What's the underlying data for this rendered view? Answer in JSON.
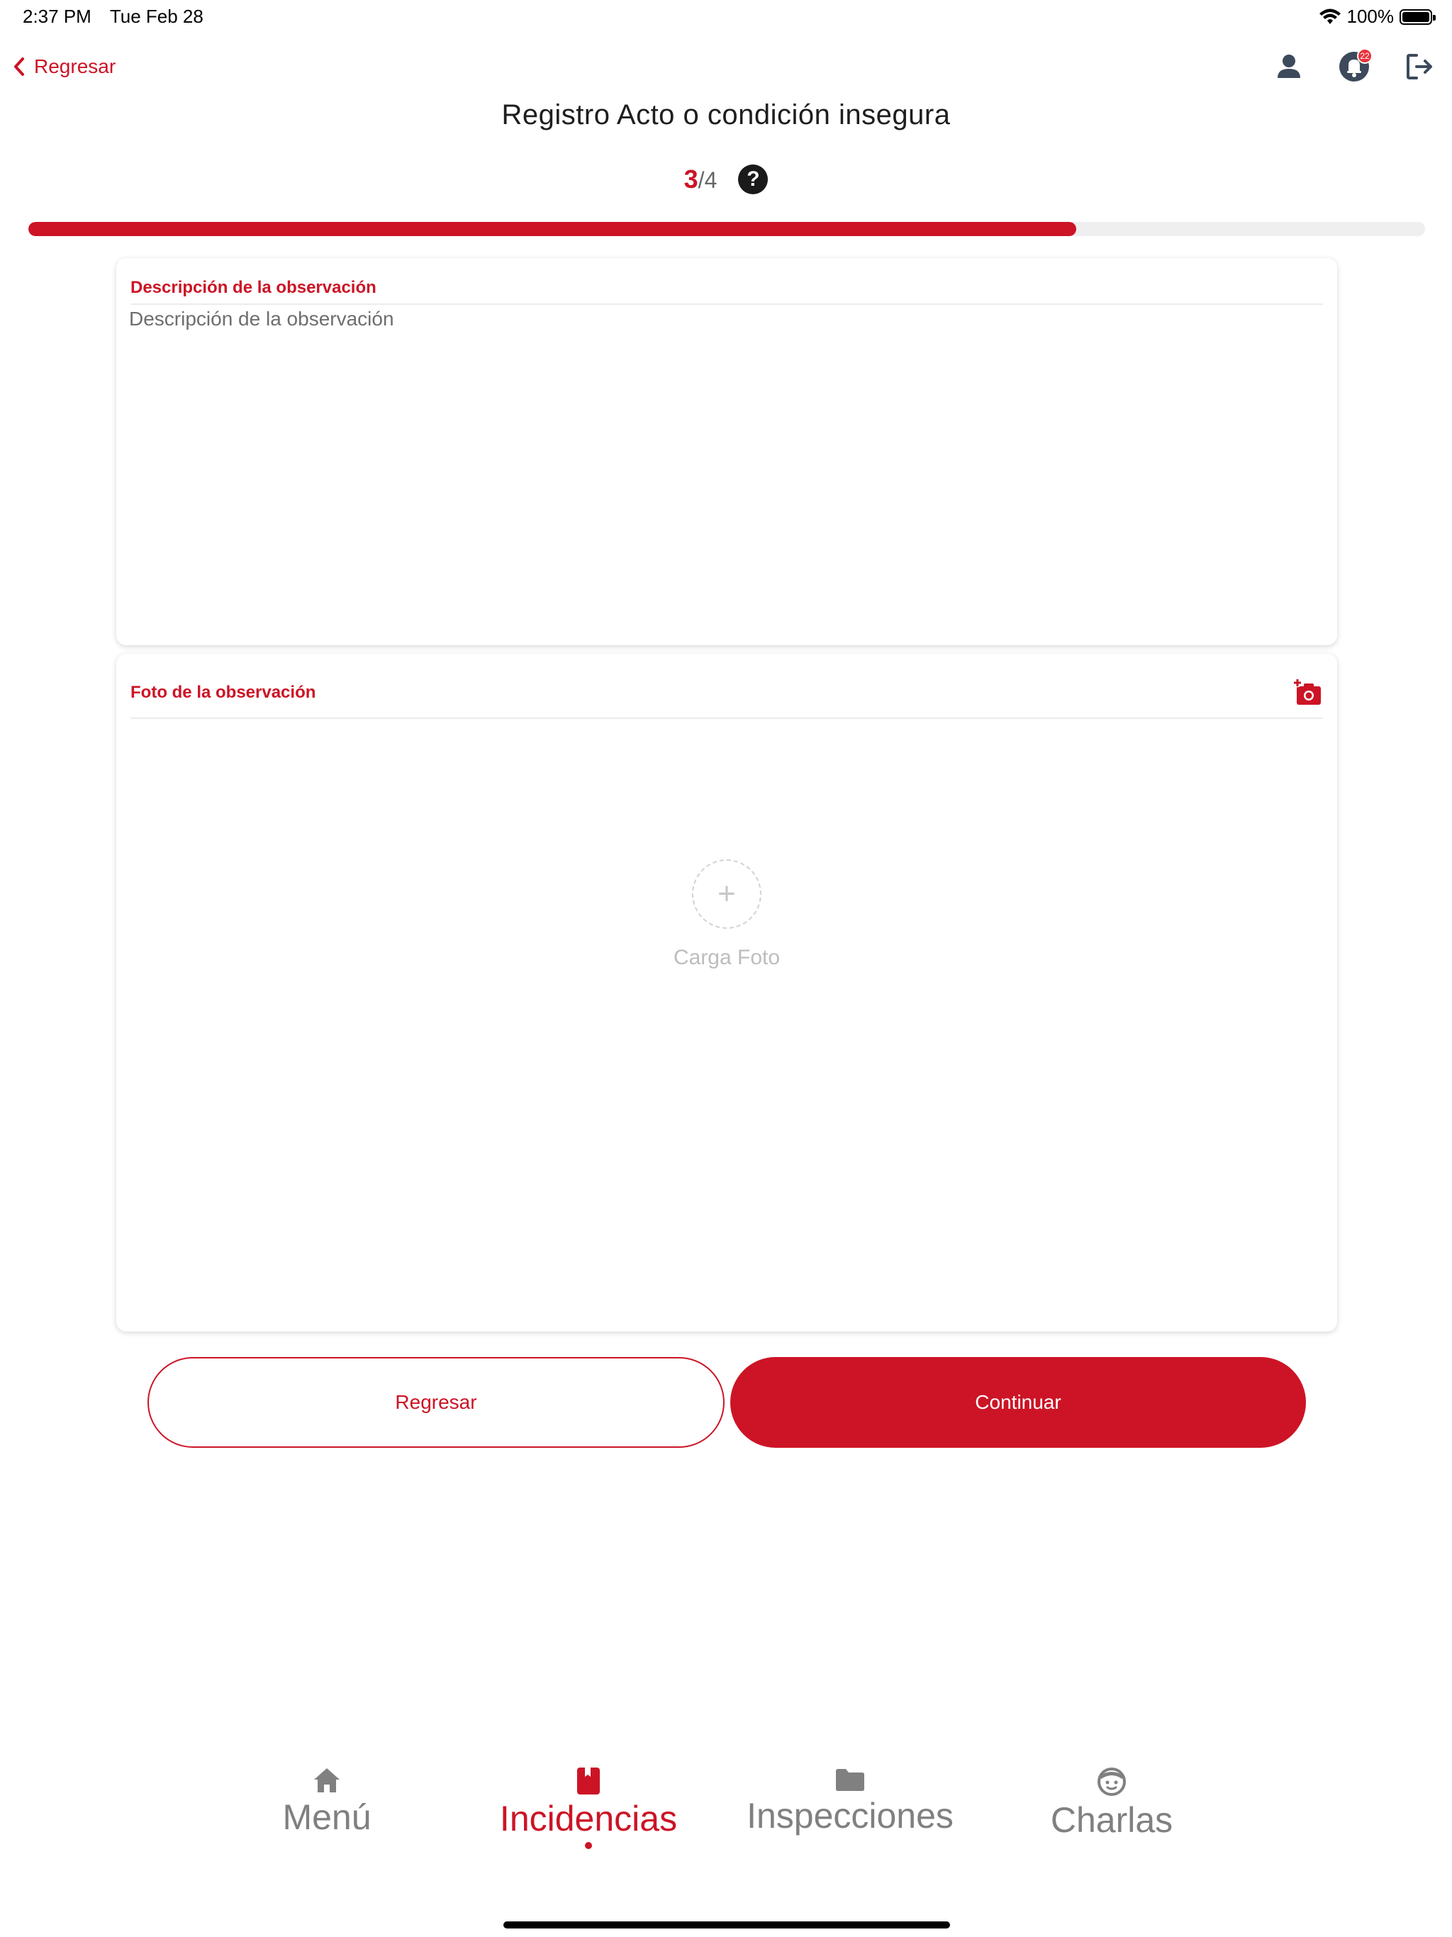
{
  "status_bar": {
    "time": "2:37 PM",
    "date": "Tue Feb 28",
    "battery_text": "100%"
  },
  "header": {
    "back_label": "Regresar",
    "title": "Registro Acto o condición insegura",
    "notification_count": "22",
    "icons": [
      "user-icon",
      "bell-icon",
      "logout-icon"
    ]
  },
  "stepper": {
    "current": "3",
    "total": "/4",
    "progress": 0.75
  },
  "description_card": {
    "title": "Descripción de la observación",
    "placeholder": "Descripción de la observación",
    "value": ""
  },
  "photo_card": {
    "title": "Foto de la observación",
    "upload_label": "Carga Foto"
  },
  "actions": {
    "back_label": "Regresar",
    "continue_label": "Continuar"
  },
  "bottom_nav": {
    "tabs": [
      {
        "label": "Menú",
        "icon": "home-icon",
        "active": false
      },
      {
        "label": "Incidencias",
        "icon": "incident-icon",
        "active": true
      },
      {
        "label": "Inspecciones",
        "icon": "folder-icon",
        "active": false
      },
      {
        "label": "Charlas",
        "icon": "face-icon",
        "active": false
      }
    ]
  },
  "colors": {
    "accent": "#cc1426",
    "inactive": "#808080",
    "track": "#efefef"
  }
}
